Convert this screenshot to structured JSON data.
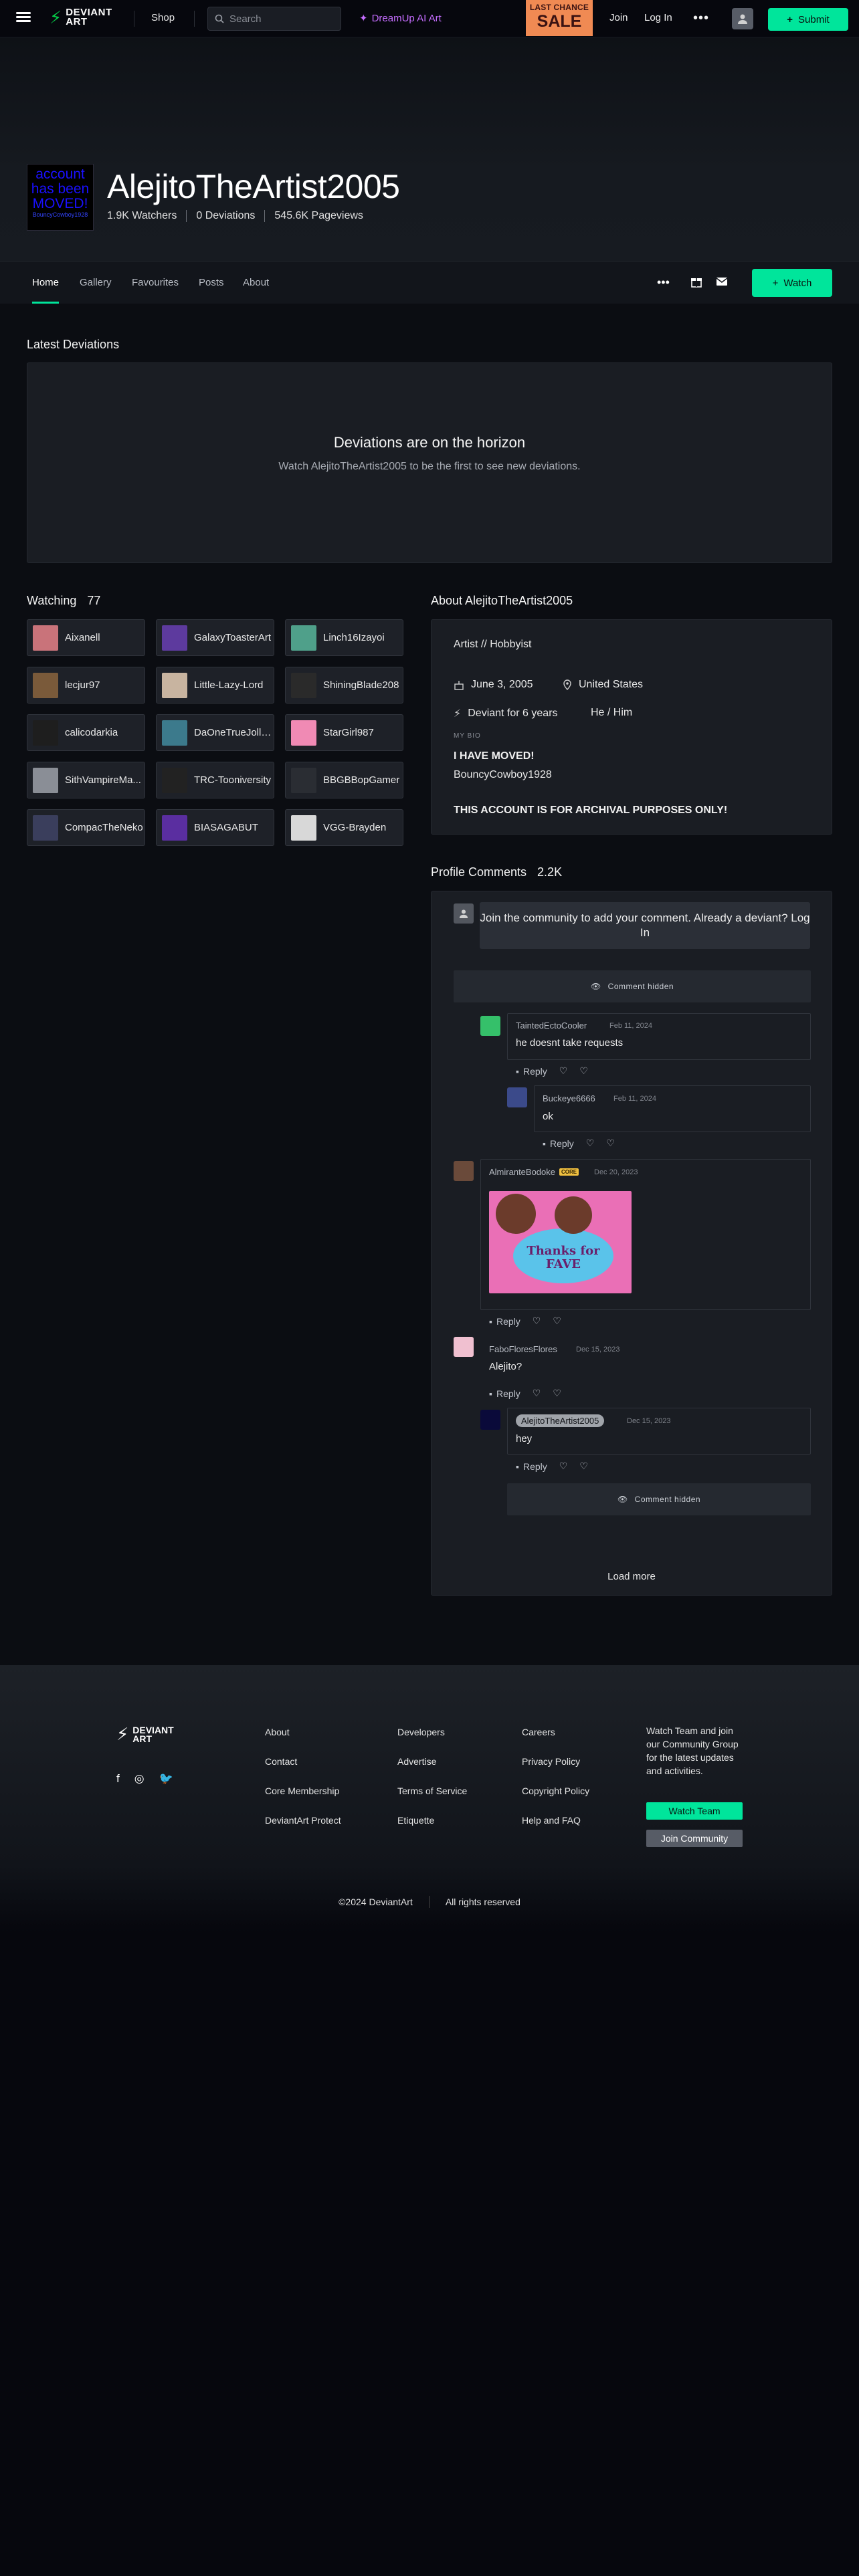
{
  "topbar": {
    "logo_text": "DEVIANT ART",
    "shop": "Shop",
    "search_placeholder": "Search",
    "dreamup": "DreamUp AI Art",
    "sale_line1": "LAST CHANCE",
    "sale_line2": "SALE",
    "join": "Join",
    "login": "Log In",
    "submit": "Submit"
  },
  "profile": {
    "avatar_text": "account has been MOVED!",
    "avatar_sub": "BouncyCowboy1928",
    "name": "AlejitoTheArtist2005",
    "watchers": "1.9K Watchers",
    "deviations": "0 Deviations",
    "pageviews": "545.6K Pageviews"
  },
  "tabs": [
    "Home",
    "Gallery",
    "Favourites",
    "Posts",
    "About"
  ],
  "watch_button": "Watch",
  "latest": {
    "heading": "Latest Deviations",
    "empty_title": "Deviations are on the horizon",
    "empty_sub": "Watch AlejitoTheArtist2005 to be the first to see new deviations."
  },
  "watching": {
    "heading": "Watching",
    "count": "77",
    "users": [
      {
        "name": "Aixanell",
        "color": "#c9737a"
      },
      {
        "name": "GalaxyToasterArt",
        "color": "#5d3a9e"
      },
      {
        "name": "Linch16Izayoi",
        "color": "#4fa08a"
      },
      {
        "name": "lecjur97",
        "color": "#7a5a3a"
      },
      {
        "name": "Little-Lazy-Lord",
        "color": "#c8b4a0"
      },
      {
        "name": "ShiningBlade208",
        "color": "#2a2a2a"
      },
      {
        "name": "calicodarkia",
        "color": "#1e1e1e"
      },
      {
        "name": "DaOneTrueJolly...",
        "color": "#3c7a8c"
      },
      {
        "name": "StarGirl987",
        "color": "#f08ab4"
      },
      {
        "name": "SithVampireMa...",
        "color": "#8a8e96"
      },
      {
        "name": "TRC-Tooniversity",
        "color": "#222222"
      },
      {
        "name": "BBGBBopGamer",
        "color": "#2a2d33"
      },
      {
        "name": "CompacTheNeko",
        "color": "#3a3e5c"
      },
      {
        "name": "BIASAGABUT",
        "color": "#5a2ea0"
      },
      {
        "name": "VGG-Brayden",
        "color": "#d8d8d8"
      }
    ]
  },
  "about": {
    "heading": "About AlejitoTheArtist2005",
    "role": "Artist  //  Hobbyist",
    "birthday": "June 3, 2005",
    "location": "United States",
    "member": "Deviant for 6 years",
    "pronouns": "He / Him",
    "my_bio_label": "MY BIO",
    "bio1": "I HAVE MOVED!",
    "bio2": "BouncyCowboy1928",
    "bio3": "THIS ACCOUNT IS FOR ARCHIVAL PURPOSES ONLY!"
  },
  "comments": {
    "heading": "Profile Comments",
    "count": "2.2K",
    "join_prompt": "Join the community to add your comment. Already a deviant? Log In",
    "hidden_label": "Comment hidden",
    "items": [
      {
        "user": "TaintedEctoCooler",
        "date": "Feb 11, 2024",
        "text": "he doesnt take requests"
      },
      {
        "user": "Buckeye6666",
        "date": "Feb 11, 2024",
        "text": "ok"
      },
      {
        "user": "AlmiranteBodoke",
        "badge": "CORE",
        "date": "Dec 20, 2023",
        "image_text": "Thanks for FAVE"
      },
      {
        "user": "FaboFloresFlores",
        "date": "Dec 15, 2023",
        "text": "Alejito?"
      },
      {
        "user": "AlejitoTheArtist2005",
        "date": "Dec 15, 2023",
        "text": "hey"
      }
    ],
    "reply": "Reply",
    "load_more": "Load more"
  },
  "footer": {
    "logo_text": "DEVIANT ART",
    "col1": [
      "About",
      "Contact",
      "Core Membership",
      "DeviantArt Protect"
    ],
    "col2": [
      "Developers",
      "Advertise",
      "Terms of Service",
      "Etiquette"
    ],
    "col3": [
      "Careers",
      "Privacy Policy",
      "Copyright Policy",
      "Help and FAQ"
    ],
    "watch_text": "Watch Team and join our Community Group for the latest updates and activities.",
    "watch_team": "Watch Team",
    "join_community": "Join Community",
    "copyright": "©2024 DeviantArt",
    "rights": "All rights reserved"
  },
  "colors": {
    "accent": "#00e59b",
    "brand_green": "#05cc47",
    "dreamup": "#c56dff",
    "sale": "#f08a53"
  }
}
